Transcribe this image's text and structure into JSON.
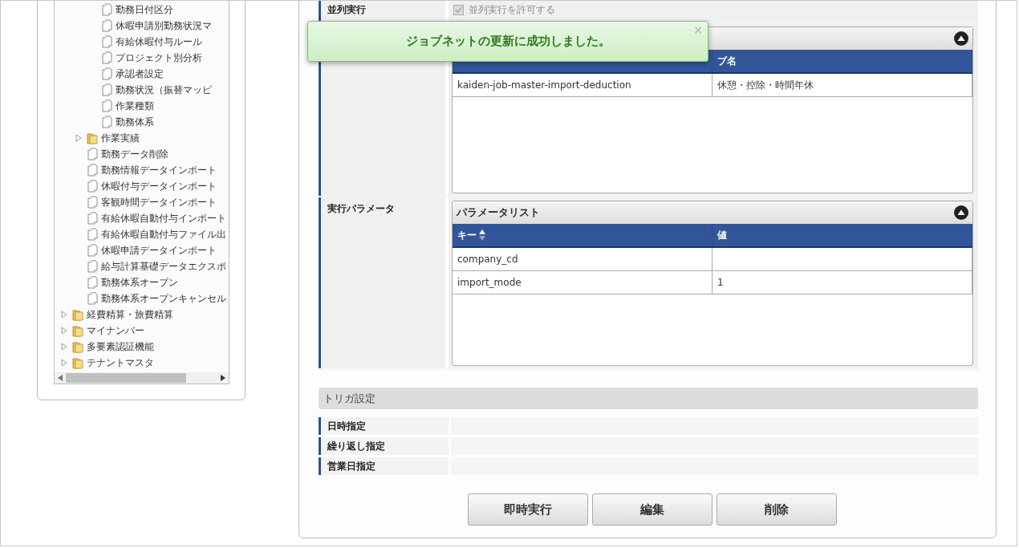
{
  "tree": [
    {
      "children": [
        {
          "children": [
            {
              "label": "勤務日付区分",
              "kind": "file"
            },
            {
              "label": "休暇申請別勤務状況マ",
              "kind": "file"
            },
            {
              "label": "有給休暇付与ルール",
              "kind": "file"
            },
            {
              "label": "プロジェクト別分析",
              "kind": "file"
            },
            {
              "label": "承認者設定",
              "kind": "file"
            },
            {
              "label": "勤務状況（振替マッピ",
              "kind": "file"
            },
            {
              "label": "作業種類",
              "kind": "file"
            },
            {
              "label": "勤務体系",
              "kind": "file"
            }
          ]
        },
        {
          "label": "作業実績",
          "kind": "folder",
          "expanded": false
        },
        {
          "label": "勤務データ削除",
          "kind": "file"
        },
        {
          "label": "勤務情報データインポート",
          "kind": "file"
        },
        {
          "label": "休暇付与データインポート",
          "kind": "file"
        },
        {
          "label": "客観時間データインポート",
          "kind": "file"
        },
        {
          "label": "有給休暇自動付与インポート",
          "kind": "file"
        },
        {
          "label": "有給休暇自動付与ファイル出",
          "kind": "file"
        },
        {
          "label": "休暇申請データインポート",
          "kind": "file"
        },
        {
          "label": "給与計算基礎データエクスポ",
          "kind": "file"
        },
        {
          "label": "勤務体系オープン",
          "kind": "file"
        },
        {
          "label": "勤務体系オープンキャンセル",
          "kind": "file"
        }
      ]
    },
    {
      "label": "経費精算・旅費精算",
      "kind": "folder",
      "expanded": false
    },
    {
      "label": "マイナンバー",
      "kind": "folder",
      "expanded": false
    },
    {
      "label": "多要素認証機能",
      "kind": "folder",
      "expanded": false
    },
    {
      "label": "テナントマスタ",
      "kind": "folder",
      "expanded": false
    }
  ],
  "concurrent": {
    "label": "並列実行",
    "option": "並列実行を許可する",
    "checked": true,
    "disabled": true
  },
  "job_table": {
    "columns": [
      "",
      "ブ名"
    ],
    "rows": [
      [
        "kaiden-job-master-import-deduction",
        "休憩・控除・時間年休"
      ]
    ]
  },
  "params": {
    "label": "実行パラメータ",
    "title": "パラメータリスト",
    "columns": [
      "キー",
      "値"
    ],
    "rows": [
      [
        "company_cd",
        ""
      ],
      [
        "import_mode",
        "1"
      ]
    ]
  },
  "trigger": {
    "title": "トリガ設定",
    "rows": [
      {
        "label": "日時指定"
      },
      {
        "label": "繰り返し指定"
      },
      {
        "label": "営業日指定"
      }
    ]
  },
  "buttons": [
    "即時実行",
    "編集",
    "削除"
  ],
  "toast": {
    "message": "ジョブネットの更新に成功しました。",
    "close": "×"
  }
}
